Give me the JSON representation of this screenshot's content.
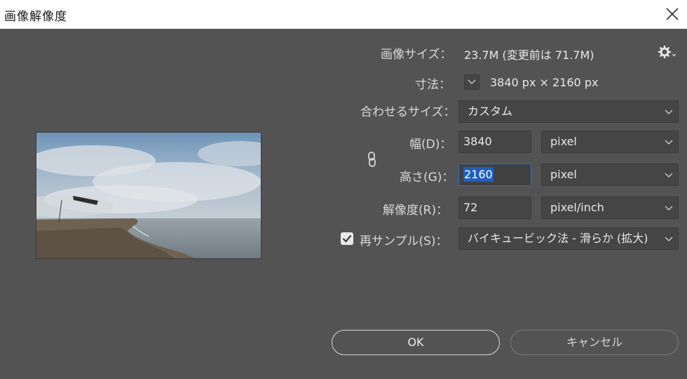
{
  "window": {
    "title": "画像解像度"
  },
  "info": {
    "image_size_label": "画像サイズ：",
    "image_size_value": "23.7M (変更前は 71.7M)",
    "dimensions_label": "寸法：",
    "dimensions_value": "3840 px × 2160 px"
  },
  "fit_to": {
    "label": "合わせるサイズ：",
    "value": "カスタム"
  },
  "width": {
    "label": "幅(D)：",
    "value": "3840",
    "unit": "pixel"
  },
  "height": {
    "label": "高さ(G)：",
    "value": "2160",
    "unit": "pixel"
  },
  "resolution": {
    "label": "解像度(R)：",
    "value": "72",
    "unit": "pixel/inch"
  },
  "resample": {
    "label": "再サンプル(S)：",
    "checked": true,
    "method": "バイキュービック法 - 滑らか (拡大)"
  },
  "buttons": {
    "ok": "OK",
    "cancel": "キャンセル"
  },
  "icons": {
    "close": "close-icon",
    "gear": "gear-icon",
    "link": "link-icon",
    "chevron": "chevron-down-icon",
    "check": "check-icon"
  },
  "colors": {
    "dialog_bg": "#535353",
    "field_bg": "#454545",
    "focus_border": "#2f71c8",
    "selection": "#1f5fbf"
  }
}
